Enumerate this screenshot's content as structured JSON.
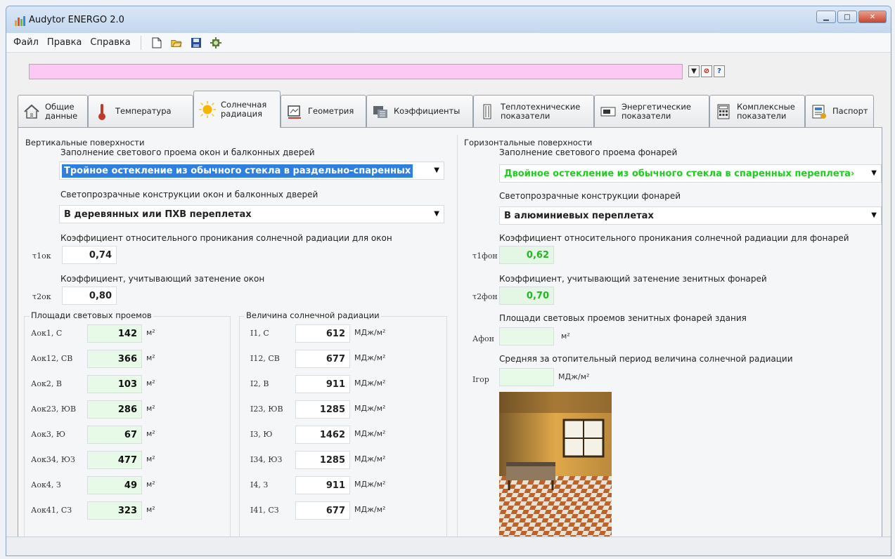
{
  "window": {
    "title": "Audytor ENERGO 2.0"
  },
  "menu": [
    {
      "label": "Файл"
    },
    {
      "label": "Правка"
    },
    {
      "label": "Справка"
    }
  ],
  "toolbar_icons": [
    "new-file-icon",
    "open-folder-icon",
    "save-icon",
    "settings-icon"
  ],
  "tabs": [
    {
      "label": "Общие\nданные",
      "icon": "home-icon"
    },
    {
      "label": "Температура",
      "icon": "thermometer-icon"
    },
    {
      "label": "Солнечная\nрадиация",
      "icon": "sun-icon",
      "active": true
    },
    {
      "label": "Геометрия",
      "icon": "geometry-icon"
    },
    {
      "label": "Коэффициенты",
      "icon": "coefficients-icon"
    },
    {
      "label": "Теплотехнические\nпоказатели",
      "icon": "building-icon"
    },
    {
      "label": "Энергетические\nпоказатели",
      "icon": "energy-icon"
    },
    {
      "label": "Комплексные\nпоказатели",
      "icon": "calculator-icon"
    },
    {
      "label": "Паспорт",
      "icon": "passport-icon"
    }
  ],
  "left": {
    "group_title": "Вертикальные поверхности",
    "fill_label": "Заполнение светового проема окон и балконных дверей",
    "fill_value": "Тройное остекление из обычного стекла в раздельно-спаренных",
    "constr_label": "Светопрозрачные конструкции окон и балконных дверей",
    "constr_value": "В деревянных или ПХВ переплетах",
    "coef1_label": "Коэффициент относительного проникания солнечной радиации для окон",
    "coef1_symbol": "τ1ок",
    "coef1_value": "0,74",
    "coef2_label": "Коэффициент, учитывающий затенение окон",
    "coef2_symbol": "τ2ок",
    "coef2_value": "0,80",
    "areas_title": "Площади световых проемов",
    "area_unit": "м²",
    "areas": [
      {
        "label": "Аок1, С",
        "value": "142"
      },
      {
        "label": "Аок12, СВ",
        "value": "366"
      },
      {
        "label": "Аок2, В",
        "value": "103"
      },
      {
        "label": "Аок23, ЮВ",
        "value": "286"
      },
      {
        "label": "Аок3, Ю",
        "value": "67"
      },
      {
        "label": "Аок34, ЮЗ",
        "value": "477"
      },
      {
        "label": "Аок4, З",
        "value": "49"
      },
      {
        "label": "Аок41, СЗ",
        "value": "323"
      }
    ],
    "rad_title": "Величина солнечной радиации",
    "rad_unit": "МДж/м²",
    "radiation": [
      {
        "label": "I1, С",
        "value": "612"
      },
      {
        "label": "I12, СВ",
        "value": "677"
      },
      {
        "label": "I2, В",
        "value": "911"
      },
      {
        "label": "I23, ЮВ",
        "value": "1285"
      },
      {
        "label": "I3, Ю",
        "value": "1462"
      },
      {
        "label": "I34, ЮЗ",
        "value": "1285"
      },
      {
        "label": "I4, З",
        "value": "911"
      },
      {
        "label": "I41, СЗ",
        "value": "677"
      }
    ]
  },
  "right": {
    "group_title": "Горизонтальные поверхности",
    "fill_label": "Заполнение светового проема фонарей",
    "fill_value": "Двойное остекление из обычного стекла в спаренных переплета›",
    "constr_label": "Светопрозрачные конструкции фонарей",
    "constr_value": "В алюминиевых переплетах",
    "coef1_label": "Коэффициент относительного проникания солнечной радиации для фонарей",
    "coef1_symbol": "τ1фон",
    "coef1_value": "0,62",
    "coef2_label": "Коэффициент, учитывающий затенение зенитных фонарей",
    "coef2_symbol": "τ2фон",
    "coef2_value": "0,70",
    "area_label": "Площади световых проемов зенитных фонарей здания",
    "area_symbol": "Афон",
    "area_value": "",
    "area_unit": "м²",
    "rad_label": "Средняя за отопительный период величина солнечной радиации",
    "rad_symbol": "Iгор",
    "rad_value": "",
    "rad_unit": "МДж/м²"
  },
  "colors": {
    "pink_field": "#fbc9f4",
    "selection_blue": "#2f7fdf",
    "green_text": "#1ecd1e",
    "green_fill": "#e7f9e7"
  }
}
